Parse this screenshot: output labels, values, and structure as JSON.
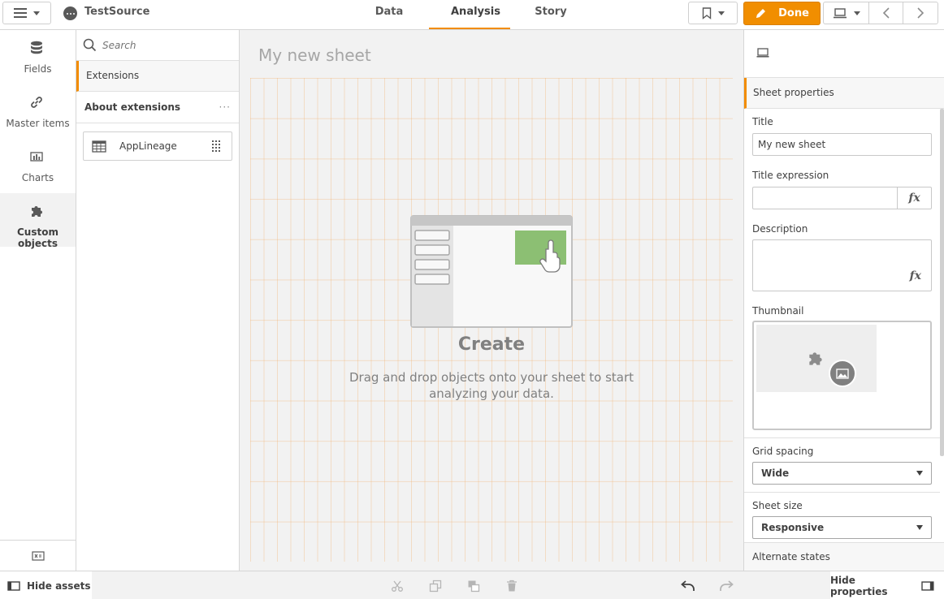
{
  "app": {
    "name": "TestSource"
  },
  "nav": {
    "tabs": [
      "Data",
      "Analysis",
      "Story"
    ],
    "active": "Analysis"
  },
  "toolbar": {
    "done_label": "Done"
  },
  "rail": {
    "items": [
      {
        "label": "Fields",
        "icon": "database-icon"
      },
      {
        "label": "Master items",
        "icon": "link-icon"
      },
      {
        "label": "Charts",
        "icon": "bar-chart-icon"
      },
      {
        "label": "Custom objects",
        "icon": "puzzle-icon"
      }
    ],
    "active": "Custom objects"
  },
  "assets": {
    "search_placeholder": "Search",
    "extensions_tab": "Extensions",
    "about_label": "About extensions",
    "more": "···",
    "items": [
      {
        "label": "AppLineage",
        "icon": "table-icon"
      }
    ]
  },
  "canvas": {
    "sheet_title": "My new sheet",
    "create_title": "Create",
    "create_text": "Drag and drop objects onto your sheet to start analyzing your data."
  },
  "properties": {
    "header": "Sheet properties",
    "title_label": "Title",
    "title_value": "My new sheet",
    "title_expression_label": "Title expression",
    "title_expression_value": "",
    "fx": "fx",
    "description_label": "Description",
    "thumbnail_label": "Thumbnail",
    "grid_spacing_label": "Grid spacing",
    "grid_spacing_value": "Wide",
    "sheet_size_label": "Sheet size",
    "sheet_size_value": "Responsive",
    "alternate_states_label": "Alternate states"
  },
  "bottom": {
    "hide_assets": "Hide assets",
    "hide_properties": "Hide properties"
  },
  "colors": {
    "accent": "#f28c00",
    "done": "#f18e00",
    "canvas": "#f2f2f2"
  }
}
